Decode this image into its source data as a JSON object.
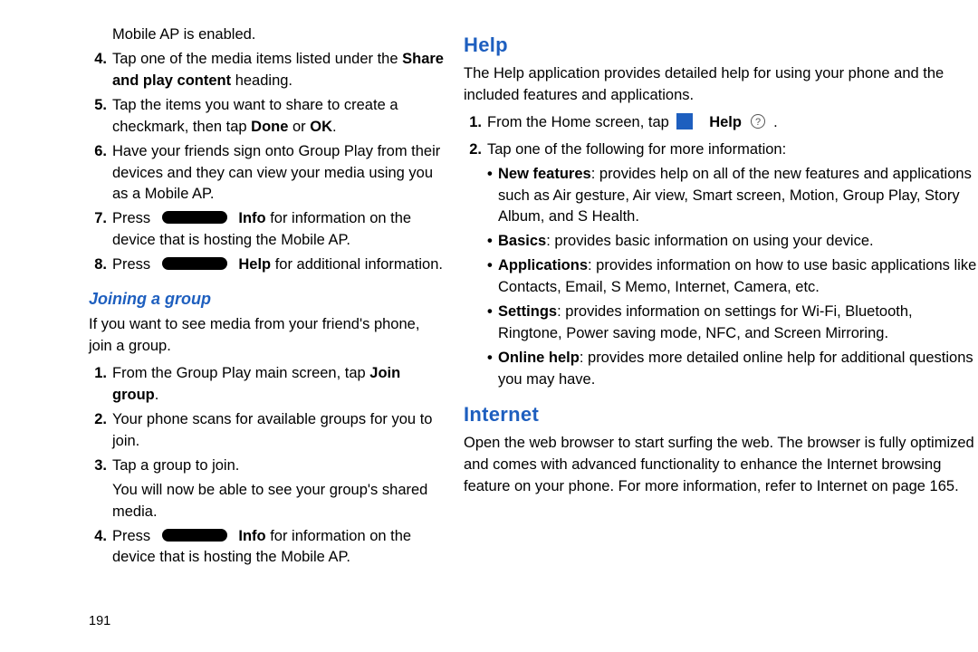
{
  "page_number": "191",
  "left": {
    "mobile_ap_enabled": "Mobile AP is enabled.",
    "step4_a": "Tap one of the media items listed under the ",
    "step4_bold": "Share and play content",
    "step4_b": " heading.",
    "step5_a": "Tap the items you want to share to create a checkmark, then tap ",
    "step5_bold1": "Done",
    "step5_mid": " or ",
    "step5_bold2": "OK",
    "step5_end": ".",
    "step6": "Have your friends sign onto Group Play from their devices and they can view your media using you as a Mobile AP.",
    "step7_a": "Press ",
    "step7_bold": "Info",
    "step7_b": " for information on the device that is hosting the Mobile AP.",
    "step8_a": "Press ",
    "step8_bold": "Help",
    "step8_b": " for additional information.",
    "join_heading": "Joining a group",
    "join_intro": "If you want to see media from your friend's phone, join a group.",
    "j1_a": "From the Group Play main screen, tap ",
    "j1_bold": "Join group",
    "j1_end": ".",
    "j2": "Your phone scans for available groups for you to join.",
    "j3": "Tap a group to join.",
    "j3_cont": "You will now be able to see your group's shared media.",
    "j4_a": "Press ",
    "j4_bold": "Info",
    "j4_b": " for information on the device that is hosting the Mobile AP."
  },
  "right": {
    "help_heading": "Help",
    "help_intro": "The Help application provides detailed help for using your phone and the included features and applications.",
    "h1_a": "From the Home screen, tap ",
    "h1_bold": "Help",
    "h1_end": " .",
    "h2": "Tap one of the following for more information:",
    "nf_bold": "New features",
    "nf_txt": ": provides help on all of the new features and applications such as Air gesture, Air view, Smart screen, Motion, Group Play, Story Album, and S Health.",
    "bs_bold": "Basics",
    "bs_txt": ": provides basic information on using your device.",
    "ap_bold": "Applications",
    "ap_txt": ": provides information on how to use basic applications like Contacts, Email, S Memo, Internet, Camera, etc.",
    "st_bold": "Settings",
    "st_txt": ": provides information on settings for Wi-Fi, Bluetooth, Ringtone, Power saving mode, NFC, and Screen Mirroring.",
    "oh_bold": "Online help",
    "oh_txt": ": provides more detailed online help for additional questions you may have.",
    "internet_heading": "Internet",
    "internet_intro_a": "Open the web browser to start surfing the web. The browser is fully optimized and comes with advanced functionality to enhance the Internet browsing feature on your phone. For more information, refer to ",
    "internet_ref": "Internet",
    "internet_intro_b": " on page 165."
  },
  "nums": {
    "n4": "4.",
    "n5": "5.",
    "n6": "6.",
    "n7": "7.",
    "n8": "8.",
    "n1": "1.",
    "n2": "2.",
    "n3": "3."
  }
}
